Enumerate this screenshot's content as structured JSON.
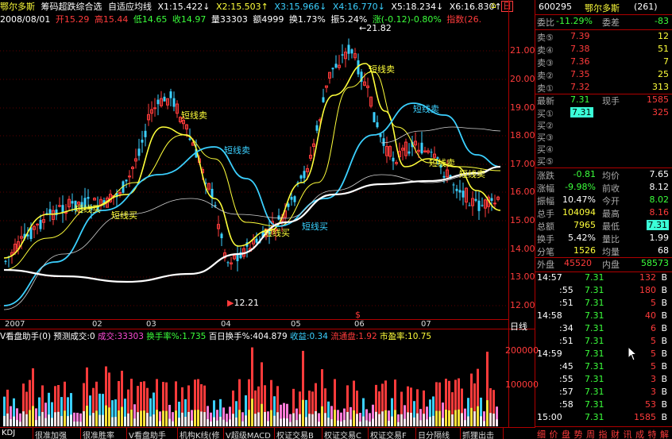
{
  "title": {
    "stock_name": "鄂尔多斯",
    "indicator": "筹码超跌综合选",
    "ma_name": "自适应均线",
    "x1": "X1:15.422↓",
    "x2": "X2:15.503↑",
    "x3": "X3:15.966↓",
    "x4": "X4:16.770↓",
    "x5": "X5:18.234↓",
    "x6": "X6:16.830↑",
    "corner_flag": "日"
  },
  "info": {
    "date": "2008/08/01",
    "open": "开15.29",
    "high": "高15.44",
    "low": "低14.65",
    "close": "收14.97",
    "volume": "量33303",
    "amount": "额4999",
    "turnover": "换1.73%",
    "amplitude": "振5.24%",
    "change": "涨(-0.12)-0.80%",
    "index": "指数(26."
  },
  "price_axis": [
    "21.00",
    "20.00",
    "19.00",
    "18.00",
    "17.00",
    "16.00",
    "15.00",
    "14.00",
    "13.00",
    "12.00"
  ],
  "chart_labels": {
    "max_label": "21.82",
    "min_label": "12.21",
    "sell1": "短线卖",
    "sell2": "短线卖",
    "sell3": "短线卖",
    "sell4": "短线卖",
    "sell5": "短线卖",
    "sell6": "短线卖",
    "buy1": "短线买",
    "buy2": "短线买",
    "buy3": "短线买",
    "buy4": "短线买",
    "dollar": "$"
  },
  "x_axis": {
    "labels": [
      "2007",
      "02",
      "03",
      "04",
      "05",
      "06",
      "07"
    ],
    "period": "日线"
  },
  "vol_bar": {
    "title": "V看盘助手(0)",
    "predict": "预测成交:0",
    "vol": "成交:33303",
    "turnover": "换手率%:1.735",
    "hundred": "百日换手%:404.879",
    "profit": "收益:0.34",
    "float": "流通盘:1.92",
    "pe": "市盈率:10.75"
  },
  "vol_axis": [
    "200000",
    "100000"
  ],
  "tabs": [
    "KDJ",
    "很准加强",
    "很准胜率",
    "V看盘助手",
    "机构K线(修",
    "V超级MACD",
    "权证交易B",
    "权证交易C",
    "权证交易F",
    "日分隔线",
    "抓狸出击"
  ],
  "panel": {
    "code": "600295",
    "name": "鄂尔多斯",
    "count": "(261)",
    "weibi_label": "委比",
    "weibi": "-11.29%",
    "weicha_label": "委差",
    "weicha": "-83",
    "sell": [
      {
        "label": "卖⑤",
        "price": "7.39",
        "vol": "12"
      },
      {
        "label": "卖④",
        "price": "7.38",
        "vol": "51"
      },
      {
        "label": "卖③",
        "price": "7.36",
        "vol": "7"
      },
      {
        "label": "卖②",
        "price": "7.35",
        "vol": "25"
      },
      {
        "label": "卖①",
        "price": "7.32",
        "vol": "313"
      }
    ],
    "latest_label": "最新",
    "latest": "7.31",
    "xianshou_label": "现手",
    "xianshou": "1585",
    "buy": [
      {
        "label": "买①",
        "price": "7.31",
        "vol": "325"
      },
      {
        "label": "买②",
        "price": "",
        "vol": ""
      },
      {
        "label": "买③",
        "price": "",
        "vol": ""
      },
      {
        "label": "买④",
        "price": "",
        "vol": ""
      },
      {
        "label": "买⑤",
        "price": "",
        "vol": ""
      }
    ],
    "stats": [
      {
        "l1": "涨跌",
        "v1": "-0.81",
        "l2": "均价",
        "v2": "7.65"
      },
      {
        "l1": "涨幅",
        "v1": "-9.98%",
        "l2": "前收",
        "v2": "8.12"
      },
      {
        "l1": "振幅",
        "v1": "10.47%",
        "l2": "今开",
        "v2": "8.02"
      },
      {
        "l1": "总手",
        "v1": "104094",
        "l2": "最高",
        "v2": "8.16"
      },
      {
        "l1": "总额",
        "v1": "7965",
        "l2": "最低",
        "v2": "7.31"
      },
      {
        "l1": "换手",
        "v1": "5.42%",
        "l2": "量比",
        "v2": "1.99"
      },
      {
        "l1": "分笔",
        "v1": "1526",
        "l2": "均量",
        "v2": "68"
      }
    ],
    "outer_label": "外盘",
    "outer": "45520",
    "inner_label": "内盘",
    "inner": "58573",
    "ticks": [
      {
        "t": "14:57",
        "p": "7.31",
        "v": "132",
        "s": "B"
      },
      {
        "t": ":55",
        "p": "7.31",
        "v": "180",
        "s": "B"
      },
      {
        "t": ":51",
        "p": "7.31",
        "v": "5",
        "s": "B"
      },
      {
        "t": "14:58",
        "p": "7.31",
        "v": "40",
        "s": "B"
      },
      {
        "t": ":34",
        "p": "7.31",
        "v": "6",
        "s": "B"
      },
      {
        "t": ":51",
        "p": "7.31",
        "v": "5",
        "s": "B"
      },
      {
        "t": "14:59",
        "p": "7.31",
        "v": "5",
        "s": "B"
      },
      {
        "t": ":45",
        "p": "7.31",
        "v": "5",
        "s": "B"
      },
      {
        "t": ":55",
        "p": "7.31",
        "v": "3",
        "s": "B"
      },
      {
        "t": ":57",
        "p": "7.31",
        "v": "3",
        "s": "B"
      },
      {
        "t": ":58",
        "p": "7.31",
        "v": "53",
        "s": "B"
      },
      {
        "t": "15:00",
        "p": "7.31",
        "v": "1585",
        "s": "B"
      }
    ],
    "bottom_tabs": [
      "细",
      "价",
      "盘",
      "势",
      "周",
      "指",
      "财",
      "讯",
      "成",
      "特",
      "解"
    ]
  }
}
